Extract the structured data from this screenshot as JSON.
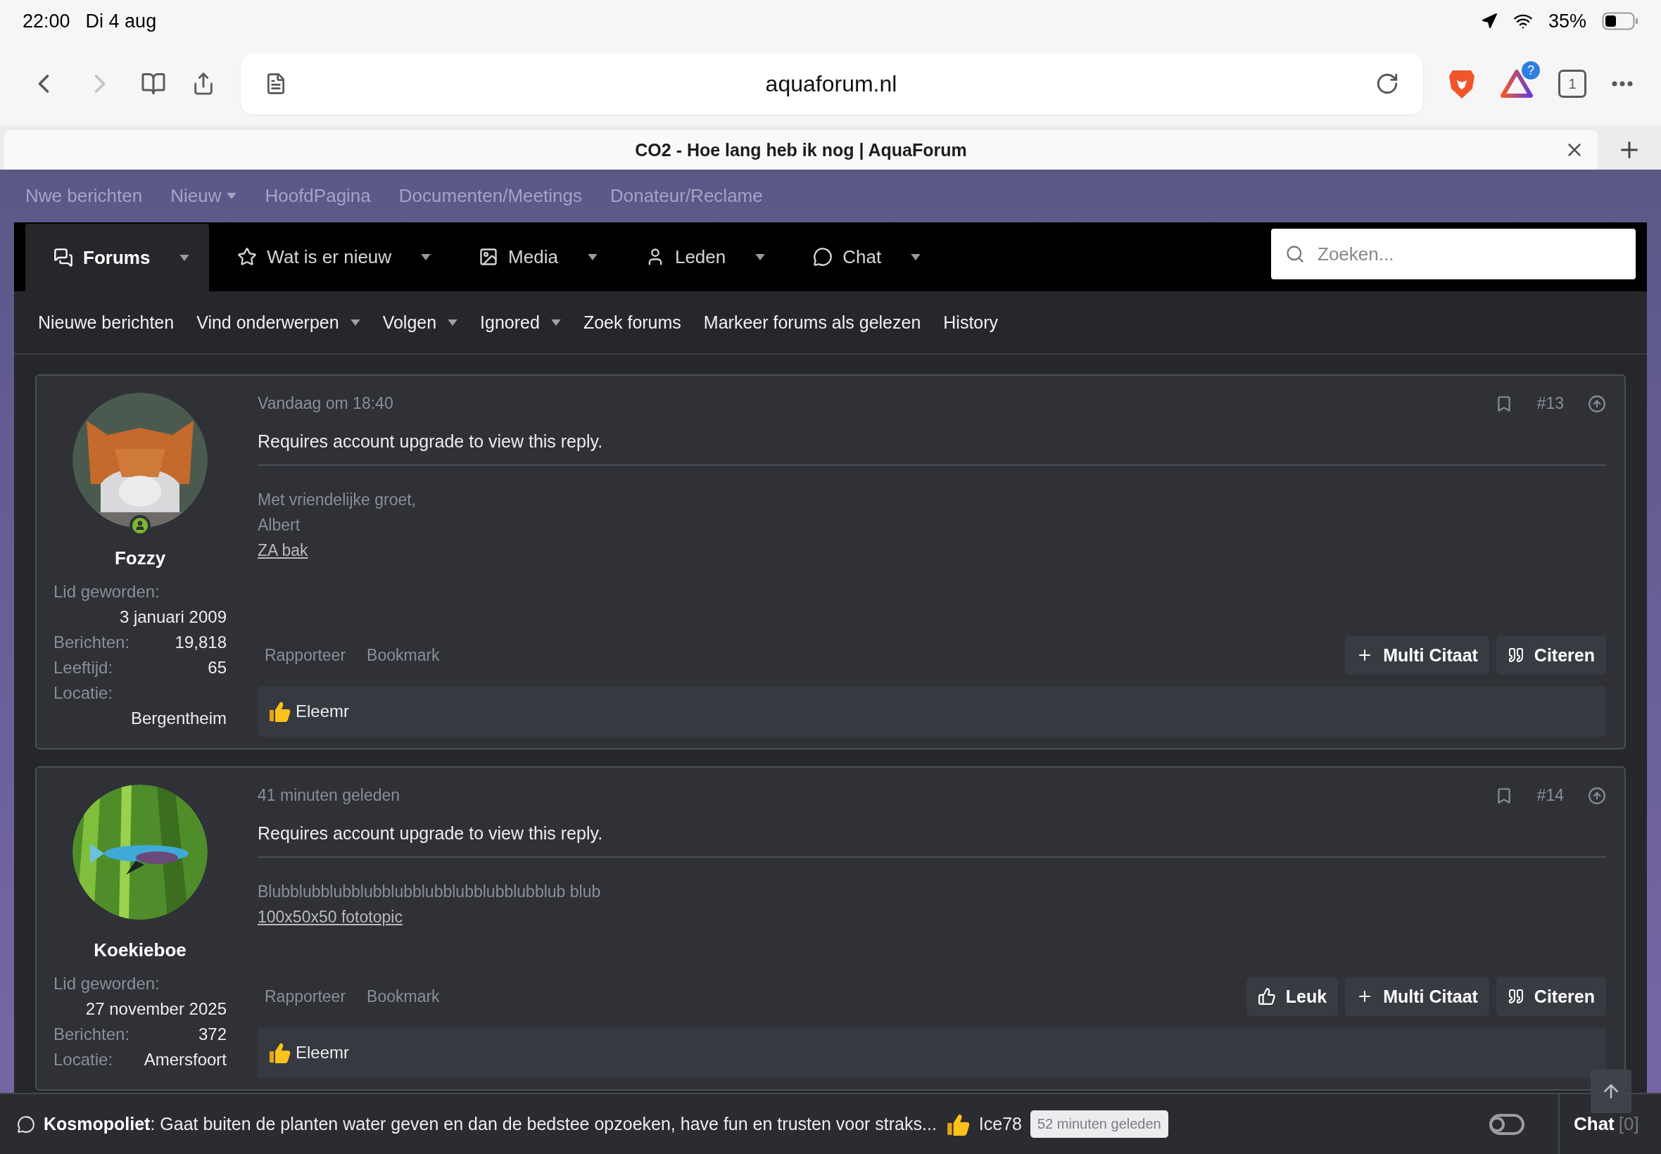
{
  "status_bar": {
    "time": "22:00",
    "date": "Di 4 aug",
    "battery": "35%"
  },
  "browser": {
    "url": "aquaforum.nl",
    "forward_disabled": true,
    "tab_count": "1",
    "extension_badge": "?",
    "tab": {
      "title": "CO2 - Hoe lang heb ik nog | AquaForum"
    }
  },
  "top_links": [
    {
      "label": "Nwe berichten",
      "has_menu": false
    },
    {
      "label": "Nieuw",
      "has_menu": true
    },
    {
      "label": "HoofdPagina",
      "has_menu": false
    },
    {
      "label": "Documenten/Meetings",
      "has_menu": false
    },
    {
      "label": "Donateur/Reclame",
      "has_menu": false
    }
  ],
  "nav": {
    "items": [
      {
        "label": "Forums",
        "kind": "forums",
        "selected": true
      },
      {
        "label": "Wat is er nieuw",
        "kind": "star",
        "selected": false
      },
      {
        "label": "Media",
        "kind": "media",
        "selected": false
      },
      {
        "label": "Leden",
        "kind": "members",
        "selected": false
      },
      {
        "label": "Chat",
        "kind": "chat",
        "selected": false
      }
    ],
    "search": {
      "placeholder": "Zoeken..."
    }
  },
  "sub_nav": [
    {
      "label": "Nieuwe berichten",
      "has_menu": false
    },
    {
      "label": "Vind onderwerpen",
      "has_menu": true
    },
    {
      "label": "Volgen",
      "has_menu": true
    },
    {
      "label": "Ignored",
      "has_menu": true
    },
    {
      "label": "Zoek forums",
      "has_menu": false
    },
    {
      "label": "Markeer forums als gelezen",
      "has_menu": false
    },
    {
      "label": "History",
      "has_menu": false
    }
  ],
  "posts": [
    {
      "user": {
        "name": "Fozzy",
        "online": true,
        "stats": [
          {
            "label": "Lid geworden:",
            "value": "3 januari 2009",
            "kind": "stacked"
          },
          {
            "label": "Berichten:",
            "value": "19,818",
            "kind": "inline"
          },
          {
            "label": "Leeftijd:",
            "value": "65",
            "kind": "inline"
          },
          {
            "label": "Locatie:",
            "value": "Bergentheim",
            "kind": "stacked"
          }
        ]
      },
      "date": "Vandaag om 18:40",
      "number": "#13",
      "message": "Requires account upgrade to view this reply.",
      "signature": [
        {
          "text": "Met vriendelijke groet,",
          "kind": "text"
        },
        {
          "text": "Albert",
          "kind": "text"
        },
        {
          "text": "ZA bak",
          "kind": "link"
        }
      ],
      "links": [
        "Rapporteer",
        "Bookmark"
      ],
      "buttons": [
        {
          "label": "Multi Citaat",
          "kind": "multiquote"
        },
        {
          "label": "Citeren",
          "kind": "quote"
        }
      ],
      "reactions": "Eleemr"
    },
    {
      "user": {
        "name": "Koekieboe",
        "online": false,
        "stats": [
          {
            "label": "Lid geworden:",
            "value": "27 november 2025",
            "kind": "stacked"
          },
          {
            "label": "Berichten:",
            "value": "372",
            "kind": "inline"
          },
          {
            "label": "Locatie:",
            "value": "Amersfoort",
            "kind": "inline"
          }
        ]
      },
      "date": "41 minuten geleden",
      "number": "#14",
      "message": "Requires account upgrade to view this reply.",
      "signature": [
        {
          "text": "Blubblubblubblubblubblubblubblubblubblub blub",
          "kind": "text"
        },
        {
          "text": "100x50x50 fototopic",
          "kind": "link"
        }
      ],
      "links": [
        "Rapporteer",
        "Bookmark"
      ],
      "buttons": [
        {
          "label": "Leuk",
          "kind": "like"
        },
        {
          "label": "Multi Citaat",
          "kind": "multiquote"
        },
        {
          "label": "Citeren",
          "kind": "quote"
        }
      ],
      "reactions": "Eleemr"
    }
  ],
  "chat_bar": {
    "message": "**Kosmopoliet**: Gaat buiten de planten water geven en dan de bedstee opzoeken, have fun en trusten voor straks...",
    "reaction_user": "Ice78",
    "time": "52 minuten geleden",
    "toggle_on": false,
    "title": "Chat",
    "count": "[0]"
  }
}
